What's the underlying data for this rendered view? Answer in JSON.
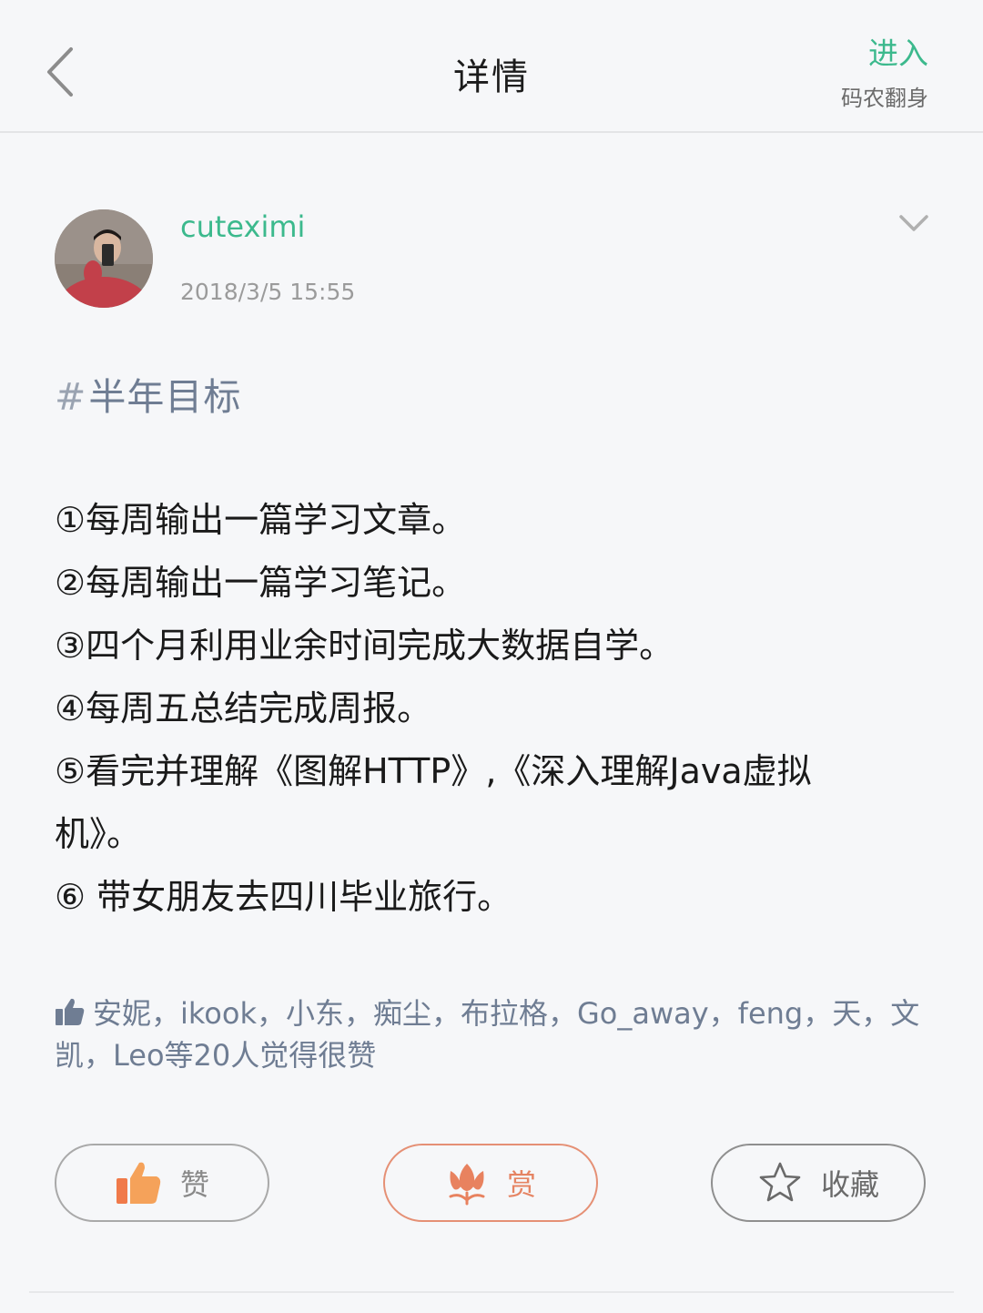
{
  "header": {
    "title": "详情",
    "enter_label": "进入",
    "channel_name": "码农翻身"
  },
  "post": {
    "author": "cuteximi",
    "time": "2018/3/5 15:55",
    "topic_hash": "#",
    "topic": "半年目标",
    "lines": [
      "①每周输出一篇学习文章。",
      "②每周输出一篇学习笔记。",
      "③四个月利用业余时间完成大数据自学。",
      "④每周五总结完成周报。",
      "⑤看完并理解《图解HTTP》,《深入理解Java虚拟",
      "机》。",
      "⑥  带女朋友去四川毕业旅行。"
    ]
  },
  "likes": {
    "text_line1": "安妮，ikook，小东，痴尘，布拉格，Go_away，feng，天，文",
    "text_line2": "凯，Leo等20人觉得很赞"
  },
  "actions": {
    "like_label": "赞",
    "reward_label": "赏",
    "favorite_label": "收藏"
  },
  "colors": {
    "accent": "#3cb98d",
    "link": "#6f7d93",
    "reward": "#e58463",
    "like_icon": "#f07a4a"
  }
}
